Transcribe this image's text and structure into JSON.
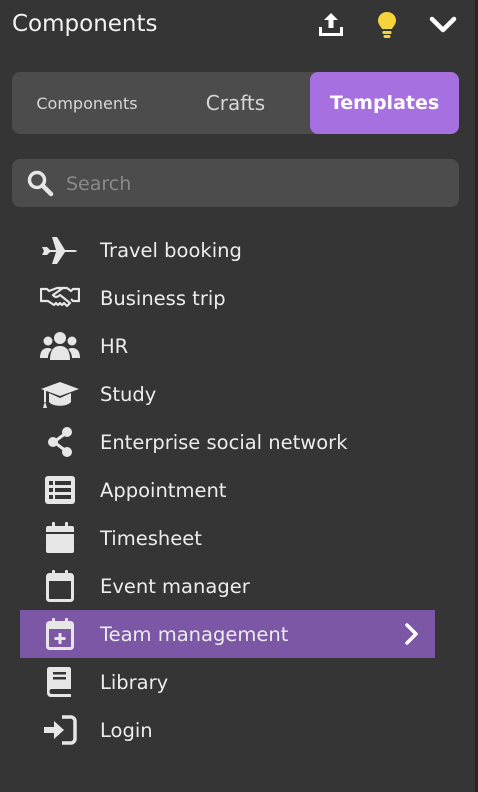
{
  "header": {
    "title": "Components"
  },
  "tabs": [
    {
      "label": "Components",
      "active": false
    },
    {
      "label": "Crafts",
      "active": false
    },
    {
      "label": "Templates",
      "active": true
    }
  ],
  "search": {
    "placeholder": "Search",
    "value": ""
  },
  "templates": [
    {
      "label": "Travel booking",
      "icon": "airplane-icon"
    },
    {
      "label": "Business trip",
      "icon": "handshake-icon"
    },
    {
      "label": "HR",
      "icon": "users-icon"
    },
    {
      "label": "Study",
      "icon": "graduation-cap-icon"
    },
    {
      "label": "Enterprise social network",
      "icon": "share-icon"
    },
    {
      "label": "Appointment",
      "icon": "list-icon"
    },
    {
      "label": "Timesheet",
      "icon": "calendar-icon"
    },
    {
      "label": "Event manager",
      "icon": "calendar-outline-icon"
    },
    {
      "label": "Team management",
      "icon": "calendar-plus-icon",
      "selected": true
    },
    {
      "label": "Library",
      "icon": "book-icon"
    },
    {
      "label": "Login",
      "icon": "sign-in-icon"
    }
  ],
  "colors": {
    "background": "#353535",
    "panel": "#4c4c4c",
    "accent": "#a770e0",
    "selected_row": "#7b57a6",
    "lightbulb": "#f5d33a"
  }
}
